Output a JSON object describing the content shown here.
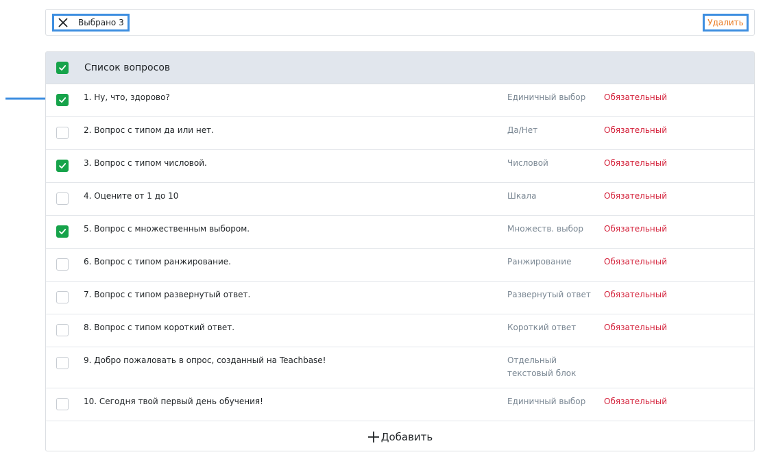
{
  "selection_bar": {
    "selected_label": "Выбрано 3",
    "delete_label": "Удалить"
  },
  "list": {
    "header_title": "Список вопросов",
    "header_checked": true,
    "questions": [
      {
        "text": "1. Ну, что, здорово?",
        "type": "Единичный выбор",
        "required": "Обязательный",
        "checked": true
      },
      {
        "text": "2. Вопрос с типом да или нет.",
        "type": "Да/Нет",
        "required": "Обязательный",
        "checked": false
      },
      {
        "text": "3. Вопрос с типом числовой.",
        "type": "Числовой",
        "required": "Обязательный",
        "checked": true
      },
      {
        "text": "4. Оцените от 1 до 10",
        "type": "Шкала",
        "required": "Обязательный",
        "checked": false
      },
      {
        "text": "5. Вопрос с множественным выбором.",
        "type": "Множеств. выбор",
        "required": "Обязательный",
        "checked": true
      },
      {
        "text": "6. Вопрос с типом ранжирование.",
        "type": "Ранжирование",
        "required": "Обязательный",
        "checked": false
      },
      {
        "text": "7. Вопрос с типом развернутый ответ.",
        "type": "Развернутый ответ",
        "required": "Обязательный",
        "checked": false
      },
      {
        "text": "8. Вопрос с типом короткий ответ.",
        "type": "Короткий ответ",
        "required": "Обязательный",
        "checked": false
      },
      {
        "text": "9. Добро пожаловать в опрос, созданный на Teachbase!",
        "type": "Отдельный текстовый блок",
        "required": "",
        "checked": false
      },
      {
        "text": "10. Сегодня твой первый день обучения!",
        "type": "Единичный выбор",
        "required": "Обязательный",
        "checked": false
      }
    ],
    "add_label": "Добавить"
  },
  "colors": {
    "checked": "#16a34a",
    "required": "#d4213a",
    "delete": "#ea7b22",
    "highlight": "#3d8ee0",
    "header_bg": "#e1e6ed"
  },
  "icons": {
    "close": "close-icon",
    "check": "check-icon",
    "plus": "plus-icon",
    "arrow": "arrow-right-icon"
  }
}
